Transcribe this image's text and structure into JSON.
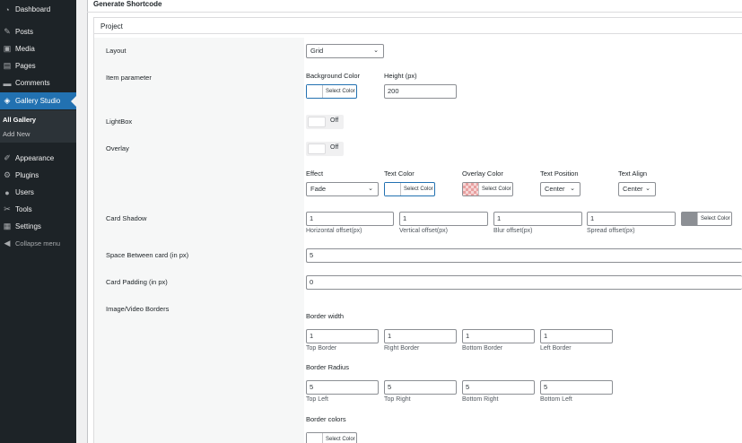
{
  "sidebar": {
    "items": [
      {
        "label": "Dashboard",
        "icon": "dashboard-icon"
      },
      {
        "label": "Posts",
        "icon": "pin-icon"
      },
      {
        "label": "Media",
        "icon": "media-icon"
      },
      {
        "label": "Pages",
        "icon": "pages-icon"
      },
      {
        "label": "Comments",
        "icon": "comments-icon"
      },
      {
        "label": "Gallery Studio",
        "icon": "gallery-icon"
      },
      {
        "label": "Appearance",
        "icon": "brush-icon"
      },
      {
        "label": "Plugins",
        "icon": "plugin-icon"
      },
      {
        "label": "Users",
        "icon": "users-icon"
      },
      {
        "label": "Tools",
        "icon": "wrench-icon"
      },
      {
        "label": "Settings",
        "icon": "settings-icon"
      }
    ],
    "submenu": [
      "All Gallery",
      "Add New"
    ],
    "collapse": "Collapse menu"
  },
  "header": {
    "title": "Generate Shortcode"
  },
  "section": {
    "title": "Project"
  },
  "rows": {
    "layout": {
      "label": "Layout",
      "value": "Grid"
    },
    "item_parameter": {
      "label": "Item parameter",
      "bg_color_label": "Background Color",
      "height_label": "Height (px)",
      "height_value": "200"
    },
    "lightbox": {
      "label": "LightBox",
      "state": "Off"
    },
    "overlay": {
      "label": "Overlay",
      "state": "Off",
      "effect_label": "Effect",
      "effect_value": "Fade",
      "text_color_label": "Text Color",
      "overlay_color_label": "Overlay Color",
      "text_position_label": "Text Position",
      "text_position_value": "Center",
      "text_align_label": "Text Align",
      "text_align_value": "Center"
    },
    "card_shadow": {
      "label": "Card Shadow",
      "h": "1",
      "v": "1",
      "blur": "1",
      "spread": "1",
      "h_label": "Horizontal offset(px)",
      "v_label": "Vertical offset(px)",
      "blur_label": "Blur offset(px)",
      "spread_label": "Spread offset(px)"
    },
    "space_between": {
      "label": "Space Between card (in px)",
      "value": "5"
    },
    "card_padding": {
      "label": "Card Padding (in px)",
      "value": "0"
    },
    "borders": {
      "label": "Image/Video Borders",
      "width_label": "Border width",
      "top": "1",
      "right": "1",
      "bottom": "1",
      "left": "1",
      "top_label": "Top Border",
      "right_label": "Right Border",
      "bottom_label": "Bottom Border",
      "left_label": "Left Border",
      "radius_label": "Border Radius",
      "tl": "5",
      "tr": "5",
      "br": "5",
      "bl": "5",
      "tl_label": "Top Left",
      "tr_label": "Top Right",
      "br_label": "Bottom Right",
      "bl_label": "Bottom Left",
      "colors_label": "Border colors"
    }
  },
  "color_button_label": "Select Color",
  "chevron": "⌄"
}
